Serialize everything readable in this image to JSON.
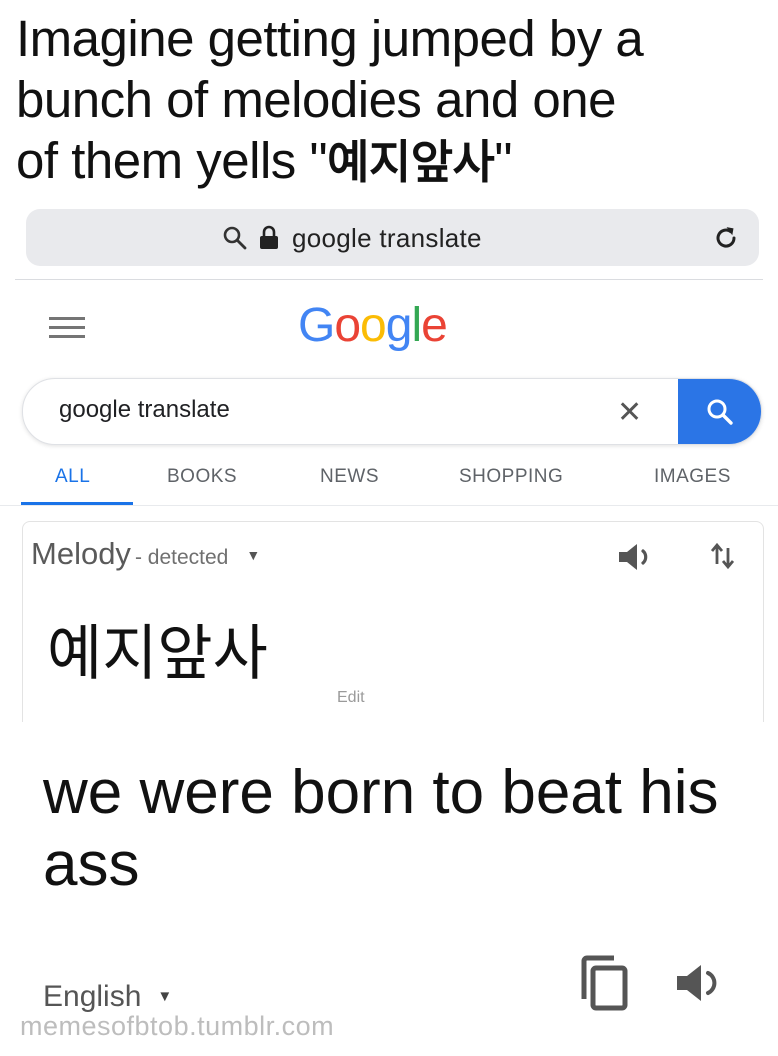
{
  "caption": {
    "line1": "Imagine getting jumped by a",
    "line2": "bunch of melodies and one",
    "line3_pre": "of them yells \"",
    "line3_kr": "예지앞사",
    "line3_post": "\""
  },
  "browser": {
    "url_text": "google translate"
  },
  "google": {
    "logo_letters": [
      "G",
      "o",
      "o",
      "g",
      "l",
      "e"
    ],
    "logo_colors": [
      "#4285F4",
      "#EA4335",
      "#FBBC05",
      "#4285F4",
      "#34A853",
      "#EA4335"
    ],
    "search_query": "google translate",
    "clear_glyph": "✕",
    "accent": "#2b75e6"
  },
  "tabs": [
    {
      "label": "ALL",
      "active": true
    },
    {
      "label": "BOOKS",
      "active": false
    },
    {
      "label": "NEWS",
      "active": false
    },
    {
      "label": "SHOPPING",
      "active": false
    },
    {
      "label": "IMAGES",
      "active": false
    }
  ],
  "translate": {
    "source_language": "Melody",
    "detected_suffix": "- detected",
    "source_text": "예지앞사",
    "edit_label": "Edit",
    "translation": "we were born to beat his ass",
    "target_language": "English"
  },
  "watermark": "memesofbtob.tumblr.com",
  "icons": {
    "search": "search-icon",
    "lock": "lock-icon",
    "reload": "reload-icon",
    "menu": "hamburger-menu-icon",
    "speaker": "speaker-icon",
    "swap": "swap-languages-icon",
    "copy": "copy-icon",
    "dropdown": "dropdown-caret-icon"
  }
}
